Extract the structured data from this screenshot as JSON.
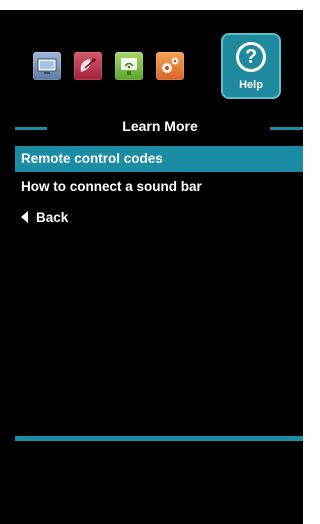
{
  "header": {
    "categories": [
      {
        "icon": "tv-icon",
        "color": "#7e97bd"
      },
      {
        "icon": "satellite-dish-icon",
        "color": "#c13e50"
      },
      {
        "icon": "network-icon",
        "color": "#86c04a"
      },
      {
        "icon": "gear-icon",
        "color": "#ea8340"
      }
    ],
    "help": {
      "label": "Help",
      "symbol": "?",
      "color": "#1f8a9e"
    }
  },
  "section": {
    "title": "Learn More"
  },
  "menu": {
    "items": [
      {
        "label": "Remote control codes",
        "selected": true
      },
      {
        "label": "How to connect a sound bar",
        "selected": false
      }
    ],
    "back_label": "Back"
  },
  "accent_color": "#1a8da4"
}
